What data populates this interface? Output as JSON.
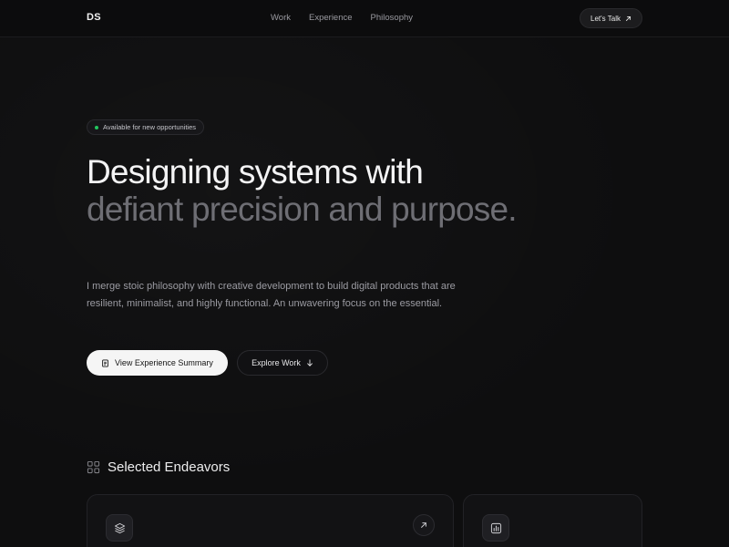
{
  "nav": {
    "logo": "DS",
    "links": [
      "Work",
      "Experience",
      "Philosophy"
    ],
    "cta": "Let's Talk",
    "cta_icon": "arrow-up-right-icon"
  },
  "hero": {
    "badge": "Available for new opportunities",
    "badge_color": "#22c55e",
    "headline_line1": "Designing systems with",
    "headline_line2": "defiant precision and purpose.",
    "lede": "I merge stoic philosophy with creative development to build digital products that are resilient, minimalist, and highly functional. An unwavering focus on the essential.",
    "primary_button": "View Experience Summary",
    "primary_icon": "document-icon",
    "secondary_button": "Explore Work",
    "secondary_icon": "arrow-down-icon"
  },
  "section": {
    "title": "Selected Endeavors",
    "icon": "grid-icon",
    "cards": [
      {
        "icon": "layers-icon",
        "action_icon": "arrow-up-right-icon"
      },
      {
        "icon": "bar-chart-icon"
      }
    ]
  },
  "colors": {
    "background": "#0e0e0f",
    "text_primary": "#f4f4f5",
    "text_muted": "#6e6e74",
    "accent_green": "#22c55e"
  }
}
